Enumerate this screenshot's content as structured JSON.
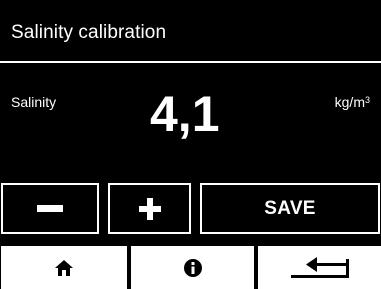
{
  "screen": {
    "title": "Salinity calibration"
  },
  "measurement": {
    "label": "Salinity",
    "value": "4,1",
    "unit_base": "kg/m",
    "unit_exponent": "3"
  },
  "controls": {
    "decrease_icon": "minus-icon",
    "increase_icon": "plus-icon",
    "save_label": "SAVE"
  },
  "navigation": {
    "home_icon": "home-icon",
    "info_icon": "info-icon",
    "back_icon": "back-arrow-icon"
  },
  "colors": {
    "background": "#000000",
    "foreground": "#ffffff"
  }
}
